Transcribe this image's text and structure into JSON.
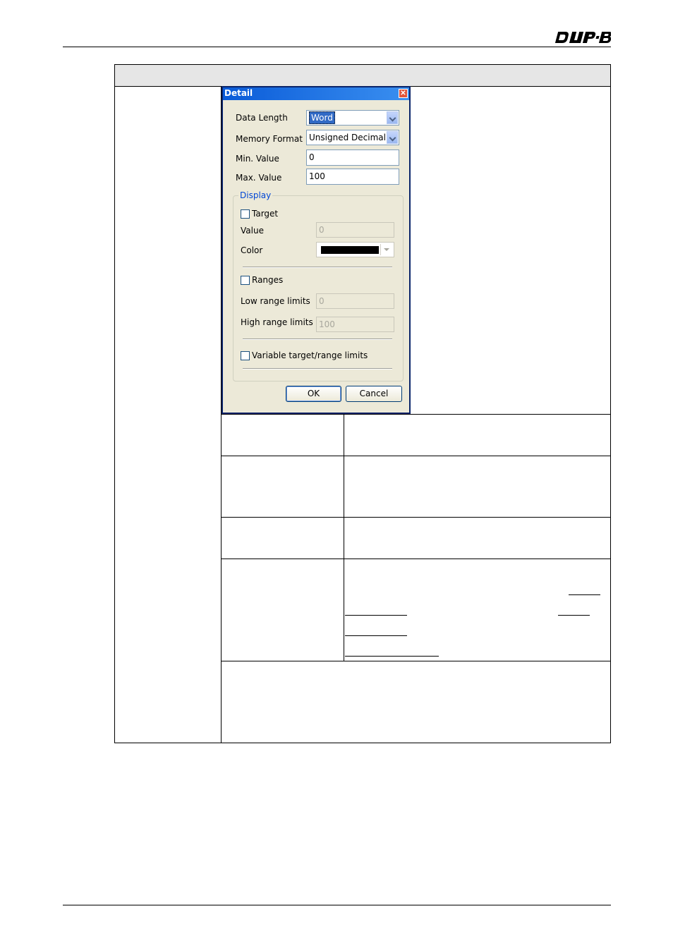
{
  "dialog": {
    "title": "Detail",
    "data_length_label": "Data Length",
    "data_length_value": "Word",
    "memory_format_label": "Memory Format",
    "memory_format_value": "Unsigned Decimal",
    "min_value_label": "Min. Value",
    "min_value": "0",
    "max_value_label": "Max. Value",
    "max_value": "100",
    "display_group_label": "Display",
    "target_label": "Target",
    "target_checked": false,
    "value_label": "Value",
    "value_field": "0",
    "color_label": "Color",
    "color_value": "#000000",
    "ranges_label": "Ranges",
    "ranges_checked": false,
    "low_range_label": "Low range limits",
    "low_range_value": "0",
    "high_range_label": "High range limits",
    "high_range_value": "100",
    "variable_label": "Variable target/range limits",
    "variable_checked": false,
    "ok_label": "OK",
    "cancel_label": "Cancel"
  },
  "colors": {
    "titlebar": "#0a5bd8",
    "dialog_bg": "#ece9d8",
    "group_title": "#0046d5",
    "header_band": "#e6e6e6"
  }
}
